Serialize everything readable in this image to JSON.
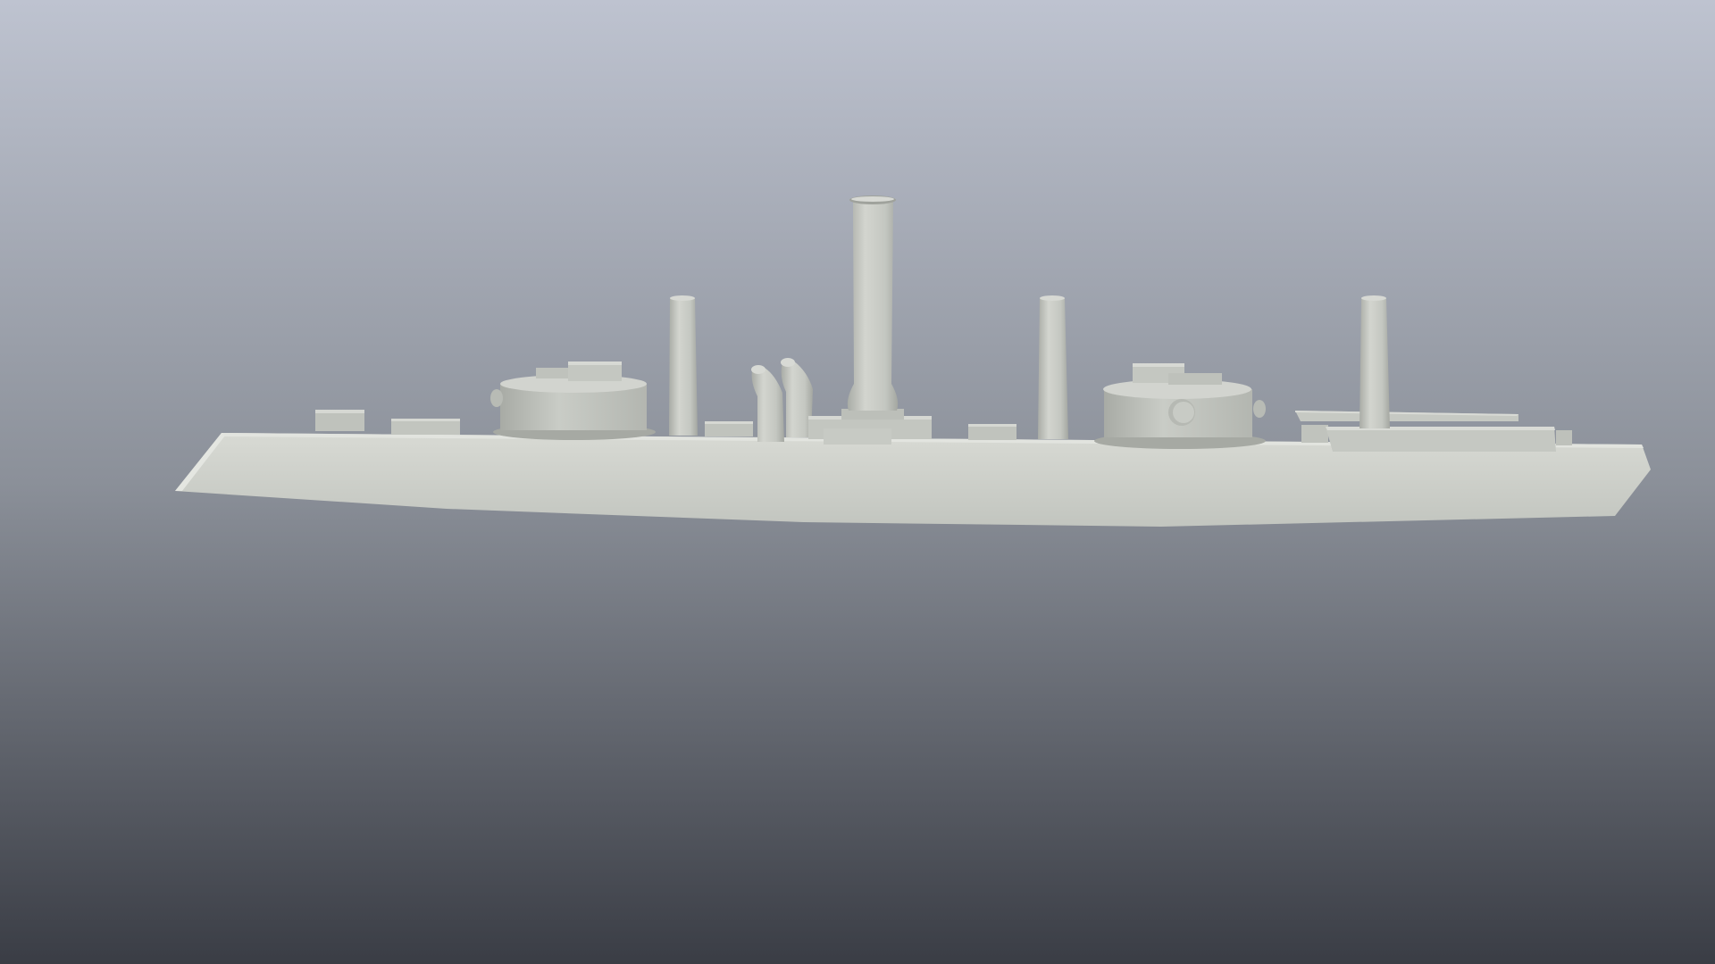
{
  "scene": {
    "background_top_color": "#BEC3D0",
    "background_mid_color": "#8B9099",
    "background_bottom_color": "#3A3D45",
    "model_color": "#C9CCC6",
    "model_shadow_color": "#9EA19C",
    "model_highlight_color": "#DDDFDA",
    "subject": "ship-model-render"
  }
}
